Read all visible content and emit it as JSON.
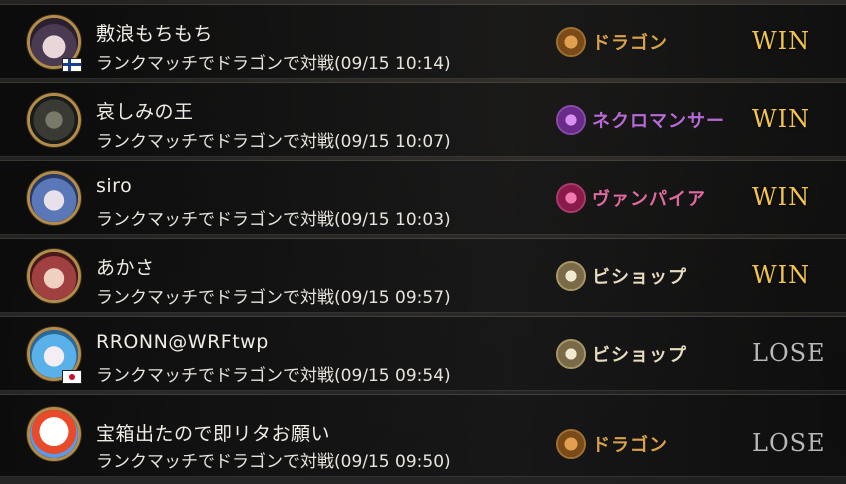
{
  "colors": {
    "win": "#f2c44a",
    "lose": "#b8b8b8",
    "dragon": "#d9a24a",
    "necromancer": "#b86ad8",
    "vampire": "#e06aa0",
    "bishop": "#e8dcc0"
  },
  "matches": [
    {
      "player": "敷浪もちもち",
      "detail": "ランクマッチでドラゴンで対戦(09/15 10:14)",
      "opponent_class": "ドラゴン",
      "class_icon": "dragon-icon",
      "result": "WIN",
      "flag": "finland"
    },
    {
      "player": "哀しみの王",
      "detail": "ランクマッチでドラゴンで対戦(09/15 10:07)",
      "opponent_class": "ネクロマンサー",
      "class_icon": "necromancer-icon",
      "result": "WIN",
      "flag": ""
    },
    {
      "player": "siro",
      "detail": "ランクマッチでドラゴンで対戦(09/15 10:03)",
      "opponent_class": "ヴァンパイア",
      "class_icon": "vampire-icon",
      "result": "WIN",
      "flag": ""
    },
    {
      "player": "あかさ",
      "detail": "ランクマッチでドラゴンで対戦(09/15 09:57)",
      "opponent_class": "ビショップ",
      "class_icon": "bishop-icon",
      "result": "WIN",
      "flag": ""
    },
    {
      "player": "RRONN@WRFtwp",
      "detail": "ランクマッチでドラゴンで対戦(09/15 09:54)",
      "opponent_class": "ビショップ",
      "class_icon": "bishop-icon",
      "result": "LOSE",
      "flag": "japan"
    },
    {
      "player": "宝箱出たので即リタお願い",
      "detail": "ランクマッチでドラゴンで対戦(09/15 09:50)",
      "opponent_class": "ドラゴン",
      "class_icon": "dragon-icon",
      "result": "LOSE",
      "flag": ""
    }
  ]
}
